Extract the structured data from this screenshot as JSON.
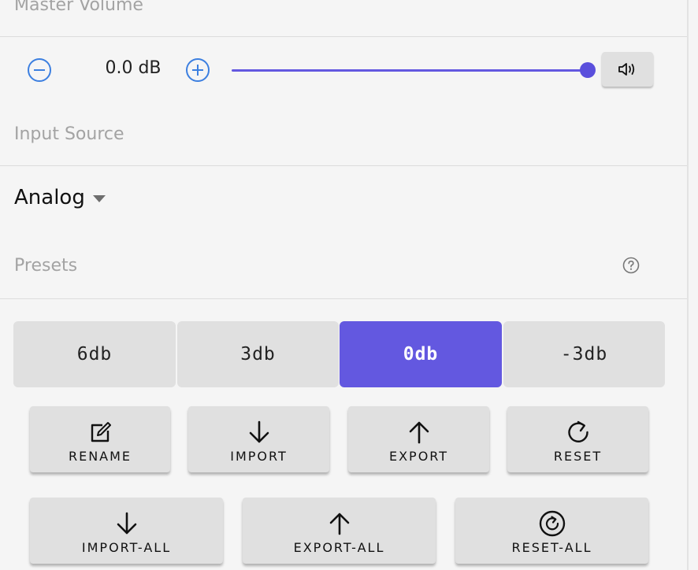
{
  "master_volume": {
    "label": "Master Volume",
    "value": "0.0 dB",
    "slider_fraction": 1.0,
    "accent_color": "#6358e0",
    "icons": {
      "decrease": "minus-circle-icon",
      "increase": "plus-circle-icon",
      "mute": "speaker-icon"
    }
  },
  "input_source": {
    "label": "Input Source",
    "selected": "Analog"
  },
  "presets": {
    "label": "Presets",
    "help_icon": "help-circle-icon",
    "options": [
      "6db",
      "3db",
      "0db",
      "-3db"
    ],
    "active_index": 2
  },
  "actions": {
    "row1": [
      {
        "label": "RENAME",
        "icon": "edit-icon"
      },
      {
        "label": "IMPORT",
        "icon": "arrow-down-icon"
      },
      {
        "label": "EXPORT",
        "icon": "arrow-up-icon"
      },
      {
        "label": "RESET",
        "icon": "refresh-icon"
      }
    ],
    "row2": [
      {
        "label": "IMPORT-ALL",
        "icon": "arrow-down-icon"
      },
      {
        "label": "EXPORT-ALL",
        "icon": "arrow-up-icon"
      },
      {
        "label": "RESET-ALL",
        "icon": "reset-circle-icon"
      }
    ]
  }
}
